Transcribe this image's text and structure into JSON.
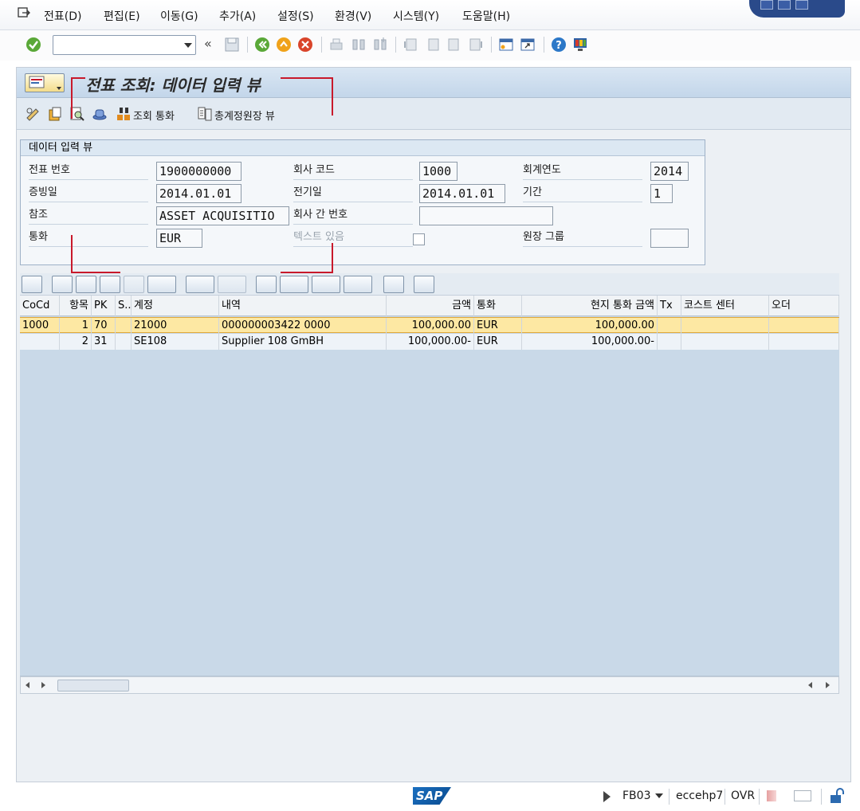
{
  "menubar": {
    "items": [
      "전표(D)",
      "편집(E)",
      "이동(G)",
      "추가(A)",
      "설정(S)",
      "환경(V)",
      "시스템(Y)",
      "도움말(H)"
    ]
  },
  "toolbar": {
    "command_value": "",
    "icons": [
      "enter-check-icon",
      "back-icon",
      "exit-icon",
      "cancel-icon",
      "print-icon",
      "find-icon",
      "find-next-icon",
      "first-page-icon",
      "prev-page-icon",
      "next-page-icon",
      "last-page-icon",
      "new-session-icon",
      "shortcut-icon",
      "help-icon",
      "customize-layout-icon"
    ]
  },
  "title": {
    "text": "전표 조회: 데이터 입력 뷰"
  },
  "appbar": {
    "button_display_currency": "조회 통화",
    "button_general_ledger_view": "총계정원장 뷰"
  },
  "header": {
    "group_title": "데이터 입력 뷰",
    "doc_number_label": "전표 번호",
    "doc_number": "1900000000",
    "company_code_label": "회사 코드",
    "company_code": "1000",
    "fiscal_year_label": "회계연도",
    "fiscal_year": "2014",
    "doc_date_label": "증빙일",
    "doc_date": "2014.01.01",
    "posting_date_label": "전기일",
    "posting_date": "2014.01.01",
    "period_label": "기간",
    "period": "1",
    "reference_label": "참조",
    "reference": "ASSET ACQUISITIO",
    "intercompany_label": "회사 간 번호",
    "intercompany": "",
    "currency_label": "통화",
    "currency": "EUR",
    "texts_exist_label": "텍스트 있음",
    "ledger_group_label": "원장 그룹",
    "ledger_group": ""
  },
  "grid": {
    "columns": [
      "CoCd",
      "항목",
      "PK",
      "S...",
      "계정",
      "내역",
      "금액",
      "통화",
      "현지 통화 금액",
      "Tx",
      "코스트 센터",
      "오더"
    ],
    "rows": [
      {
        "cocd": "1000",
        "item": "1",
        "pk": "70",
        "s": "",
        "account": "21000",
        "desc": "000000003422 0000",
        "amount": "100,000.00",
        "curr": "EUR",
        "local_amount": "100,000.00",
        "tx": "",
        "cost_center": "",
        "order": ""
      },
      {
        "cocd": "",
        "item": "2",
        "pk": "31",
        "s": "",
        "account": "SE108",
        "desc": "Supplier 108 GmBH",
        "amount": "100,000.00-",
        "curr": "EUR",
        "local_amount": "100,000.00-",
        "tx": "",
        "cost_center": "",
        "order": ""
      }
    ]
  },
  "status": {
    "logo": "SAP",
    "transaction": "FB03",
    "server": "eccehp7",
    "mode": "OVR"
  },
  "colors": {
    "selected_row": "#fde8a3",
    "grid_bg": "#c9d9e8",
    "title_bg": "#c3d6ea",
    "red_marker": "#c8192b"
  }
}
